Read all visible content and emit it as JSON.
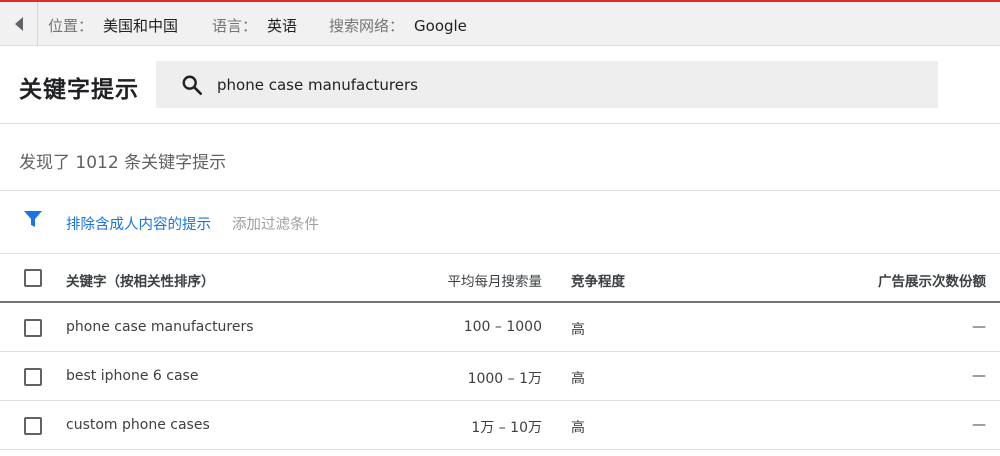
{
  "settings": {
    "location_label": "位置：",
    "location_value": "美国和中国",
    "language_label": "语言：",
    "language_value": "英语",
    "network_label": "搜索网络：",
    "network_value": "Google"
  },
  "header": {
    "title": "关键字提示",
    "search_value": "phone case manufacturers"
  },
  "results": {
    "count_text": "发现了 1012 条关键字提示"
  },
  "filters": {
    "active_filter": "排除含成人内容的提示",
    "add_filter": "添加过滤条件"
  },
  "table": {
    "columns": {
      "keyword": "关键字（按相关性排序）",
      "volume": "平均每月搜索量",
      "competition": "竞争程度",
      "share": "广告展示次数份额"
    },
    "rows": [
      {
        "keyword": "phone case manufacturers",
        "volume": "100 – 1000",
        "competition": "高",
        "share": "—"
      },
      {
        "keyword": "best iphone 6 case",
        "volume": "1000 – 1万",
        "competition": "高",
        "share": "—"
      },
      {
        "keyword": "custom phone cases",
        "volume": "1万 – 10万",
        "competition": "高",
        "share": "—"
      }
    ]
  },
  "colors": {
    "accent": "#1a73e8",
    "top_border": "#d93025"
  },
  "icons": [
    "back-arrow-icon",
    "search-icon",
    "filter-icon"
  ]
}
